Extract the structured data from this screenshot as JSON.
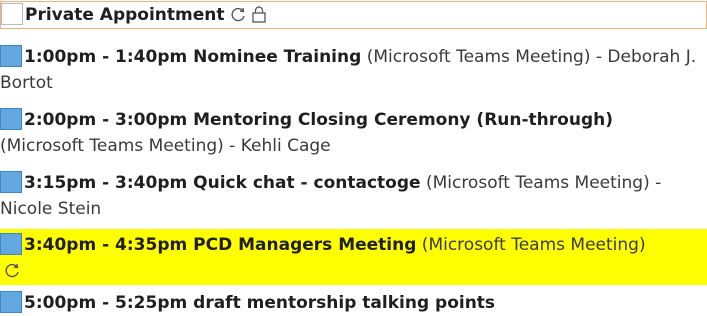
{
  "appointments": [
    {
      "title": "Private Appointment",
      "detail": "",
      "icons": [
        "recurring-icon",
        "lock-icon"
      ]
    },
    {
      "title": "1:00pm - 1:40pm Nominee Training",
      "detail": " (Microsoft Teams Meeting) - Deborah J. Bortot"
    },
    {
      "title": "2:00pm - 3:00pm Mentoring Closing Ceremony (Run-through)",
      "detail": " (Microsoft Teams Meeting) - Kehli Cage"
    },
    {
      "title": "3:15pm - 3:40pm Quick chat - contactoge",
      "detail": " (Microsoft Teams Meeting) - Nicole Stein"
    },
    {
      "title": "3:40pm - 4:35pm PCD Managers Meeting",
      "detail": " (Microsoft Teams Meeting)",
      "icons": [
        "recurring-icon"
      ],
      "highlight": "#ffff00"
    },
    {
      "title": "5:00pm - 5:25pm draft mentorship talking points",
      "detail": ""
    }
  ],
  "colors": {
    "category_blue": "#63a7e0",
    "selection_border": "#f0b07a",
    "highlight": "#ffff00"
  }
}
